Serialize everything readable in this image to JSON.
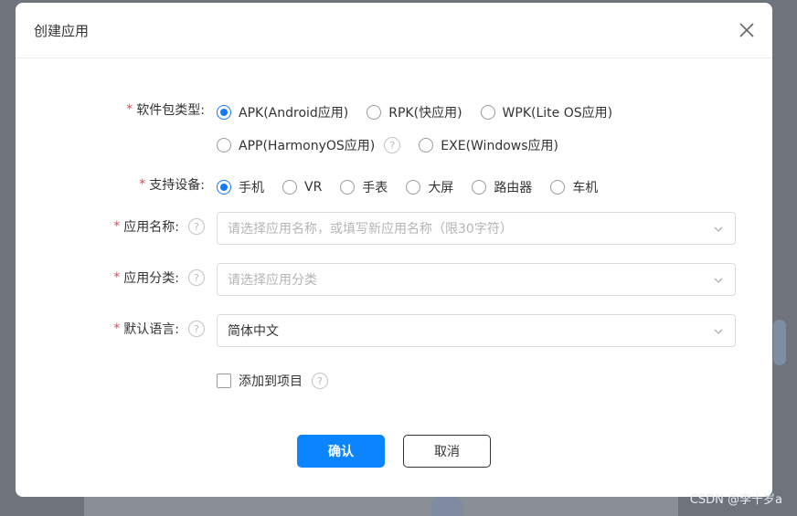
{
  "dialog": {
    "title": "创建应用",
    "close_icon": "close-icon"
  },
  "package_type": {
    "label": "软件包类型:",
    "required_mark": "*",
    "options": [
      {
        "label": "APK(Android应用)",
        "checked": true
      },
      {
        "label": "RPK(快应用)",
        "checked": false
      },
      {
        "label": "WPK(Lite OS应用)",
        "checked": false
      },
      {
        "label": "APP(HarmonyOS应用)",
        "checked": false,
        "help": "?"
      },
      {
        "label": "EXE(Windows应用)",
        "checked": false
      }
    ]
  },
  "devices": {
    "label": "支持设备:",
    "required_mark": "*",
    "options": [
      {
        "label": "手机",
        "checked": true
      },
      {
        "label": "VR",
        "checked": false
      },
      {
        "label": "手表",
        "checked": false
      },
      {
        "label": "大屏",
        "checked": false
      },
      {
        "label": "路由器",
        "checked": false
      },
      {
        "label": "车机",
        "checked": false
      }
    ]
  },
  "app_name": {
    "label": "应用名称:",
    "required_mark": "*",
    "help": "?",
    "placeholder": "请选择应用名称，或填写新应用名称（限30字符）",
    "value": ""
  },
  "app_category": {
    "label": "应用分类:",
    "required_mark": "*",
    "help": "?",
    "placeholder": "请选择应用分类",
    "value": ""
  },
  "default_language": {
    "label": "默认语言:",
    "required_mark": "*",
    "help": "?",
    "value": "简体中文"
  },
  "add_to_project": {
    "label": "添加到项目",
    "checked": false,
    "help": "?"
  },
  "buttons": {
    "confirm": "确认",
    "cancel": "取消"
  },
  "colors": {
    "primary": "#0a84ff",
    "required": "#e5484d"
  },
  "watermark": "CSDN @李十岁a"
}
